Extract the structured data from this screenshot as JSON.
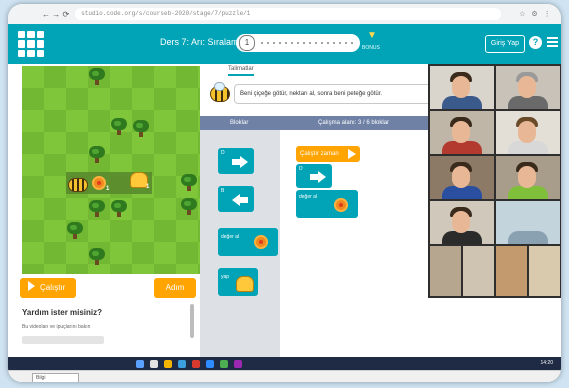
{
  "browser": {
    "nav_icons": "← → ⟳",
    "url": "studio.code.org/s/courseb-2020/stage/7/puzzle/1",
    "extensions": "☆ ⚙ ⋮"
  },
  "header": {
    "level_title": "Ders 7: Arı: Sıralama",
    "current_level": "1",
    "bonus_label": "BONUS",
    "signin_label": "Giriş Yap",
    "help_label": "?",
    "accent_color": "#00a4b6"
  },
  "game": {
    "run_label": "Çalıştır",
    "step_label": "Adım",
    "help_heading": "Yardım ister misiniz?",
    "help_subtext": "Bu videoları ve ipuçlarını bakın",
    "flower_count": "1",
    "hive_count": "1"
  },
  "instructions": {
    "tab_label": "Talimatlar",
    "text": "Beni çiçeğe götür, nektarı al, sonra beni peteğe götür."
  },
  "workspace": {
    "toolbox_label": "Bloklar",
    "workspace_label": "Çalışma alanı: 3 / 6 bloklar",
    "toolbox_blocks": [
      {
        "label": "D",
        "icon": "arrow-right-icon"
      },
      {
        "label": "B",
        "icon": "arrow-left-icon"
      },
      {
        "label": "değer al",
        "icon": "flower-icon"
      },
      {
        "label": "yap",
        "icon": "honeycomb-icon"
      }
    ],
    "program": {
      "when_run_label": "Çalıştır zaman",
      "blocks": [
        {
          "label": "D",
          "icon": "arrow-right-icon"
        },
        {
          "label": "değer al",
          "icon": "flower-icon"
        }
      ]
    }
  },
  "video_call": {
    "participant_count": 12
  },
  "footer": {
    "zoom_label": "Bilgi",
    "time": "14:20"
  }
}
